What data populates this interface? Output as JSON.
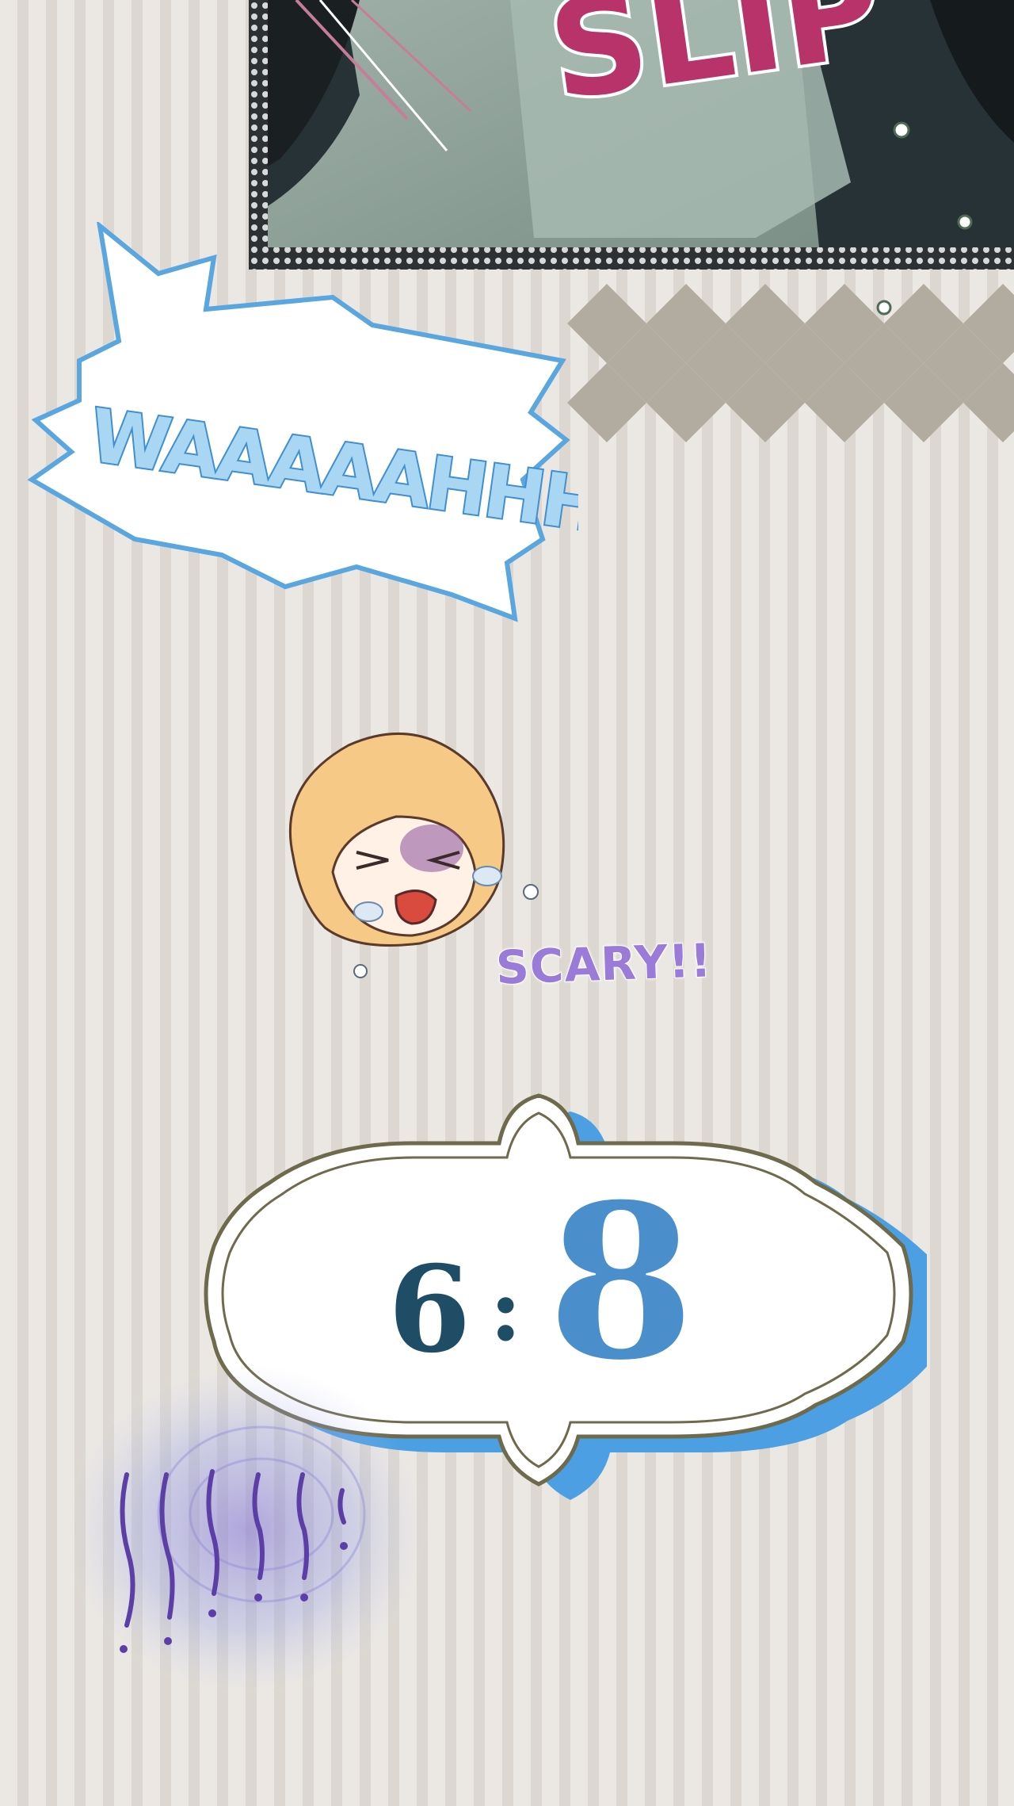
{
  "panel": {
    "sfx_text": "SLIP"
  },
  "shout": {
    "text": "WAAAAAHHHH"
  },
  "chibi": {
    "caption": "SCARY!!"
  },
  "score": {
    "left": "6",
    "separator": ":",
    "right": "8"
  },
  "tremble": {
    "marks": "!!!!!!!"
  },
  "colors": {
    "background": "#ebe8e3",
    "stripe": "#dcd8d1",
    "bubble_outline": "#5aa6df",
    "shout_text": "#8cc8ee",
    "caption": "#9b7bd8",
    "score_left": "#1f4d66",
    "score_right": "#4a8fcc",
    "plaque_shadow": "#4b9fe2",
    "plaque_border": "#6e6a4c"
  }
}
